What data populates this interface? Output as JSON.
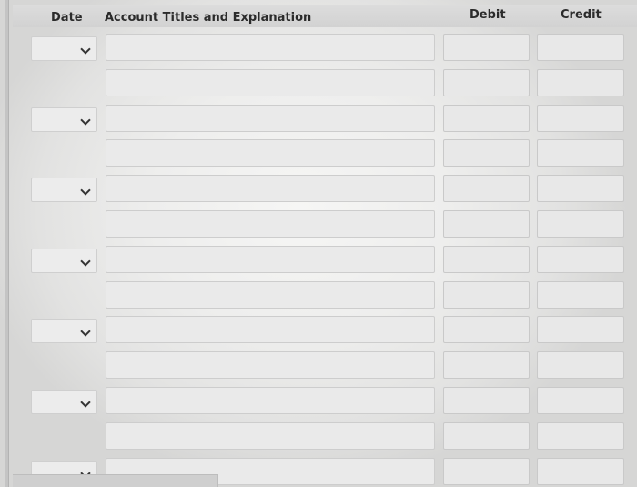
{
  "header": {
    "date_label": "Date",
    "account_label": "Account Titles and Explanation",
    "debit_label": "Debit",
    "credit_label": "Credit"
  },
  "entries": [
    {
      "date": "",
      "account": "",
      "debit": "",
      "credit": ""
    },
    {
      "date": "",
      "account": "",
      "debit": "",
      "credit": ""
    },
    {
      "date": "",
      "account": "",
      "debit": "",
      "credit": ""
    },
    {
      "date": "",
      "account": "",
      "debit": "",
      "credit": ""
    },
    {
      "date": "",
      "account": "",
      "debit": "",
      "credit": ""
    },
    {
      "date": "",
      "account": "",
      "debit": "",
      "credit": ""
    },
    {
      "date": "",
      "account": "",
      "debit": "",
      "credit": ""
    },
    {
      "date": "",
      "account": "",
      "debit": "",
      "credit": ""
    },
    {
      "date": "",
      "account": "",
      "debit": "",
      "credit": ""
    },
    {
      "date": "",
      "account": "",
      "debit": "",
      "credit": ""
    },
    {
      "date": "",
      "account": "",
      "debit": "",
      "credit": ""
    },
    {
      "date": "",
      "account": "",
      "debit": "",
      "credit": ""
    },
    {
      "date": "",
      "account": "",
      "debit": "",
      "credit": ""
    }
  ],
  "icons": {
    "date_dropdown": "chevron-down-icon"
  },
  "colors": {
    "header_background": "#d4d4d4",
    "field_border": "#cdcdcd",
    "field_background": "#eaeaea"
  }
}
